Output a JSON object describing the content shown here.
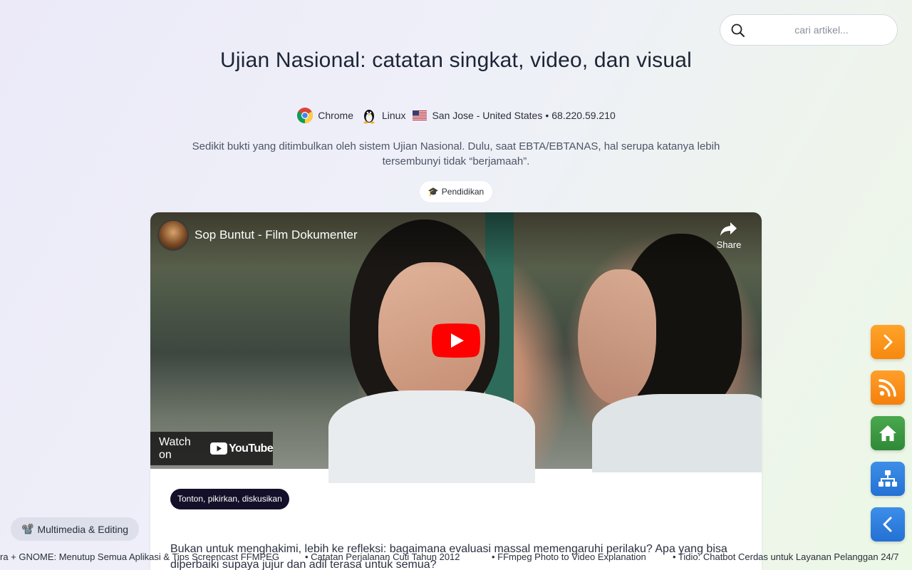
{
  "search": {
    "placeholder": "cari artikel..."
  },
  "article": {
    "title": "Ujian Nasional: catatan singkat, video, dan visual",
    "meta": {
      "browser": "Chrome",
      "os": "Linux",
      "location": "San Jose - United States",
      "separator": "•",
      "ip": "68.220.59.210"
    },
    "description": "Sedikit bukti yang ditimbulkan oleh sistem Ujian Nasional. Dulu, saat EBTA/EBTANAS, hal serupa katanya lebih tersembunyi tidak “berjamaah”.",
    "tag": {
      "icon": "🎓",
      "label": "Pendidikan"
    }
  },
  "video": {
    "channel_title": "Sop Buntut - Film Dokumenter",
    "share_label": "Share",
    "watch_label": "Watch on",
    "youtube_label": "YouTube"
  },
  "card": {
    "pill": "Tonton, pikirkan, diskusikan",
    "body": "Bukan untuk menghakimi, lebih ke refleksi: bagaimana evaluasi massal memengaruhi perilaku? Apa yang bisa diperbaiki supaya jujur dan adil terasa untuk semua?"
  },
  "category_chip": {
    "icon": "📽️",
    "label": "Multimedia & Editing"
  },
  "ticker": [
    "ra + GNOME: Menutup Semua Aplikasi & Tips Screencast FFMPEG",
    "• Catatan Perjalanan Cuti Tahun 2012",
    "• FFmpeg Photo to Video Explanation",
    "• Tidio: Chatbot Cerdas untuk Layanan Pelanggan 24/7"
  ],
  "fabs": {
    "next": "chevron-right-icon",
    "rss": "rss-icon",
    "home": "home-icon",
    "sitemap": "sitemap-icon",
    "prev": "chevron-left-icon"
  },
  "colors": {
    "fab_orange": "#f7880e",
    "fab_green": "#2f8a37",
    "fab_blue": "#2371d4",
    "pill_bg": "#141029",
    "youtube_red": "#ff0000"
  }
}
